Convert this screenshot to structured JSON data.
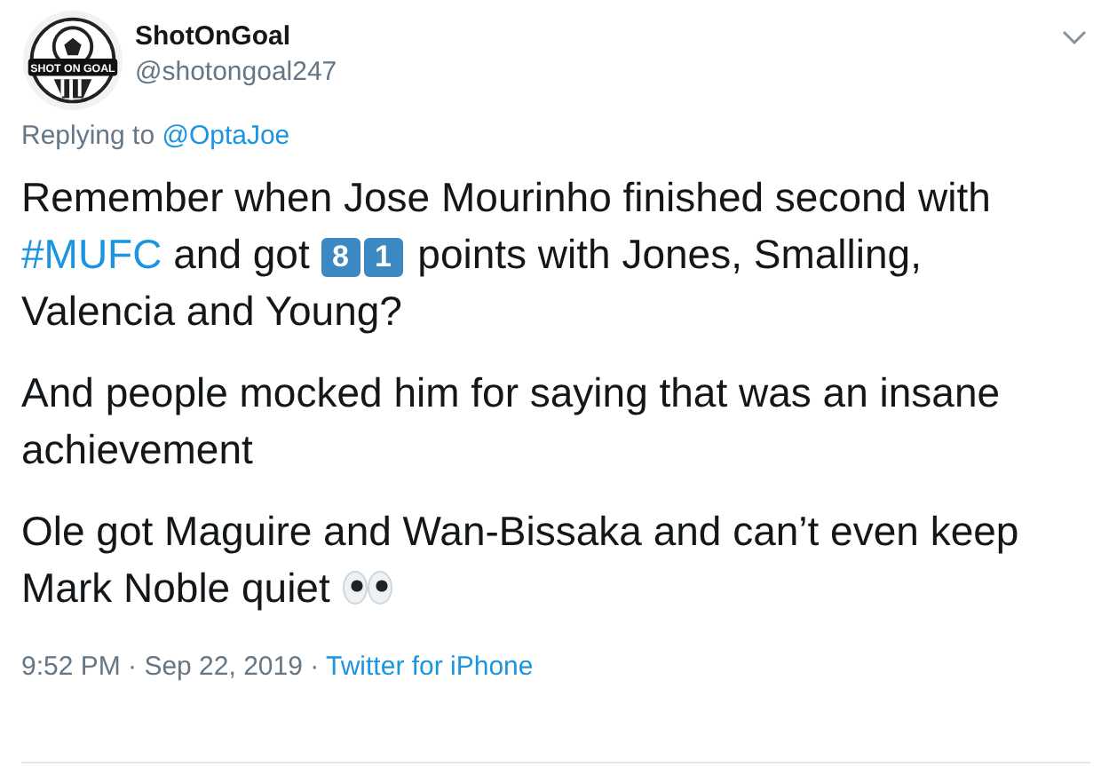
{
  "author": {
    "avatar_text": "SHOT ON GOAL",
    "name": "ShotOnGoal",
    "handle": "@shotongoal247"
  },
  "reply": {
    "prefix": "Replying to",
    "mention": "@OptaJoe"
  },
  "paragraphs": [
    {
      "segments": [
        {
          "kind": "text",
          "text": "Remember when Jose Mourinho finished second with "
        },
        {
          "kind": "hashtag",
          "text": "#MUFC"
        },
        {
          "kind": "text",
          "text": " and got "
        },
        {
          "kind": "keycap",
          "text": "8"
        },
        {
          "kind": "keycap",
          "text": "1"
        },
        {
          "kind": "text",
          "text": " points with Jones, Smalling, Valencia and Young?"
        }
      ]
    },
    {
      "segments": [
        {
          "kind": "text",
          "text": "And people mocked him for saying that was an insane achievement"
        }
      ]
    },
    {
      "segments": [
        {
          "kind": "text",
          "text": "Ole got Maguire and Wan-Bissaka and can’t even keep Mark Noble quiet "
        },
        {
          "kind": "eyes"
        }
      ]
    }
  ],
  "meta": {
    "time": "9:52 PM · Sep 22, 2019",
    "separator": "·",
    "source": "Twitter for iPhone"
  }
}
